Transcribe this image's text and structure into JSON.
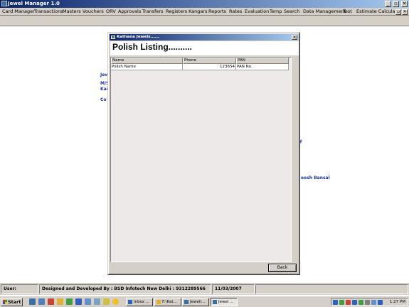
{
  "app": {
    "title": "Jewel Manager 1.0",
    "menu": [
      "Card Manager",
      "Transactions",
      "Masters",
      "Vouchers",
      "ORV",
      "Approvals",
      "Transfers",
      "Registers",
      "Kangars",
      "Reports",
      "Rates",
      "Evaluation",
      "Temp",
      "Search",
      "Data Management",
      "Test",
      "Estimate Calculator"
    ],
    "window_controls": {
      "minimize": "_",
      "restore": "▫",
      "close": "✕"
    }
  },
  "background_text": {
    "frag1": "Jev",
    "frag2": "M/S",
    "frag3": "Kar",
    "frag4": "Co",
    "frag5": "y",
    "frag6": "eesh Bansal"
  },
  "dialog": {
    "title": "Kathana Jewels......",
    "close_label": "✕",
    "heading": "Polish Listing..........",
    "columns": [
      "Name",
      "Phone",
      "PAN"
    ],
    "rows": [
      {
        "name": "Polish Name",
        "phone": "123654",
        "pan": "PAN No."
      }
    ],
    "back_label": "Back"
  },
  "statusbar": {
    "user_label": "User:",
    "credit": "Designed and Developed By : BSD Infotech New Delhi : 9312289566",
    "date": "11/03/2007"
  },
  "taskbar": {
    "start_label": "Start",
    "tasks": [
      "Inbox ...",
      "F:\\Kat...",
      "Jewell...",
      "Jewel ..."
    ],
    "clock": "1:27 PM"
  },
  "colors": {
    "title_bar": "#0a246a",
    "title_bar_end": "#a6caf0",
    "face": "#d4d0c8",
    "bg_text": "#1a2fb0"
  }
}
